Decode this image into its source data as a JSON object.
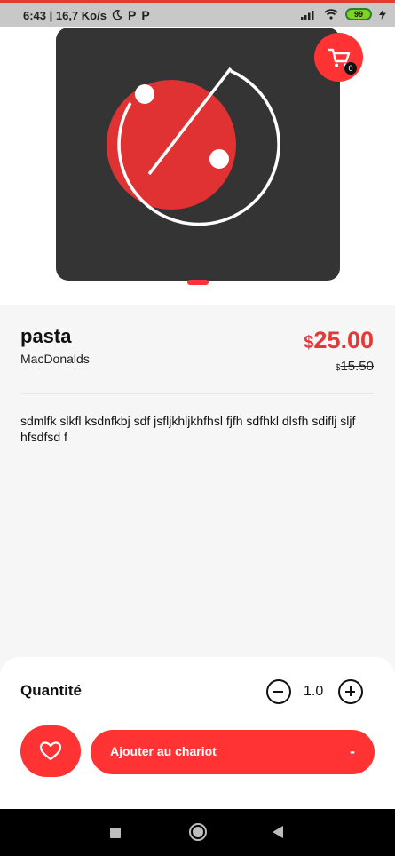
{
  "status_bar": {
    "time_speed": "6:43 | 16,7 Ko/s",
    "moon_icon": "moon-icon",
    "p1": "P",
    "p2": "P",
    "battery": "99"
  },
  "cart": {
    "count": "0"
  },
  "product": {
    "name": "pasta",
    "brand": "MacDonalds",
    "price_currency": "$",
    "price": "25.00",
    "old_price_currency": "$",
    "old_price": "15.50",
    "description": "sdmlfk slkfl ksdnfkbj sdf jsfljkhljkhfhsl fjfh sdfhkl dlsfh sdiflj sljf  hfsdfsd f"
  },
  "quantity": {
    "label": "Quantité",
    "value": "1.0"
  },
  "actions": {
    "add_to_cart": "Ajouter au chariot",
    "dash": "-"
  },
  "colors": {
    "accent": "#ff3333",
    "price": "#e53935",
    "card": "#343434"
  }
}
